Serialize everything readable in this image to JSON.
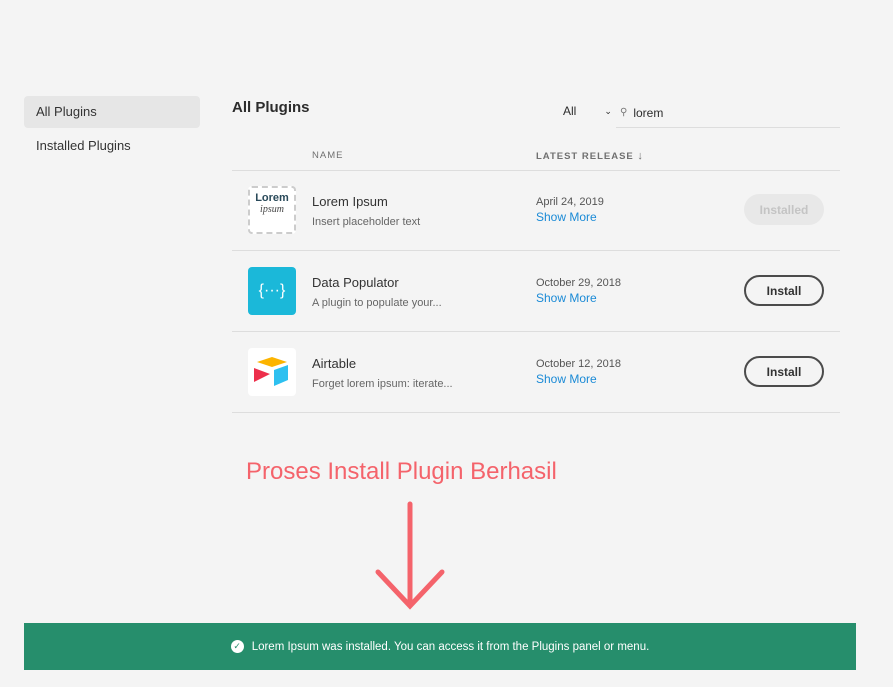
{
  "sidebar": {
    "items": [
      {
        "label": "All Plugins"
      },
      {
        "label": "Installed Plugins"
      }
    ]
  },
  "header": {
    "title": "All Plugins",
    "filter": "All",
    "search_value": "lorem"
  },
  "table": {
    "col_name": "NAME",
    "col_release": "LATEST RELEASE",
    "rows": [
      {
        "name": "Lorem Ipsum",
        "desc": "Insert placeholder text",
        "date": "April 24, 2019",
        "more": "Show More",
        "button": "Installed",
        "logo_text": [
          "Lorem",
          "ipsum"
        ]
      },
      {
        "name": "Data Populator",
        "desc": "A plugin to populate your...",
        "date": "October 29, 2018",
        "more": "Show More",
        "button": "Install",
        "logo_text": "{···}"
      },
      {
        "name": "Airtable",
        "desc": "Forget lorem ipsum: iterate...",
        "date": "October 12, 2018",
        "more": "Show More",
        "button": "Install"
      }
    ]
  },
  "annotation": "Proses Install Plugin Berhasil",
  "toast": {
    "message": "Lorem Ipsum was installed. You can access it from the Plugins panel or menu."
  },
  "colors": {
    "toast": "#268e6c",
    "annotation": "#f4636b",
    "link": "#1a8ad6"
  }
}
